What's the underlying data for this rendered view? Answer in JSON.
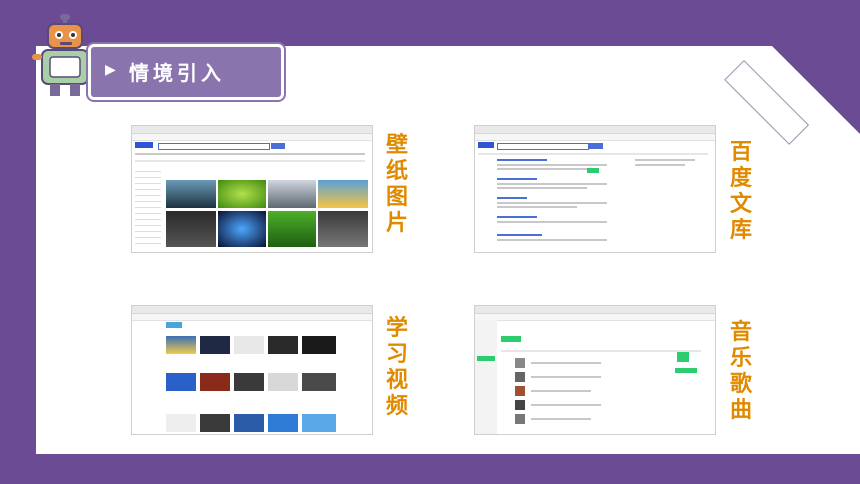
{
  "header": {
    "title": "情境引入",
    "arrow_glyph": "▶"
  },
  "panels": [
    {
      "label": "壁纸图片",
      "chars": [
        "壁",
        "纸",
        "图",
        "片"
      ]
    },
    {
      "label": "百度文库",
      "chars": [
        "百",
        "度",
        "文",
        "库"
      ]
    },
    {
      "label": "学习视频",
      "chars": [
        "学",
        "习",
        "视",
        "频"
      ]
    },
    {
      "label": "音乐歌曲",
      "chars": [
        "音",
        "乐",
        "歌",
        "曲"
      ]
    }
  ],
  "colors": {
    "background": "#6b4c94",
    "tab": "#8a74ad",
    "label": "#e08a00",
    "accent": "#4a6fd6",
    "music_green": "#2ecc71"
  }
}
